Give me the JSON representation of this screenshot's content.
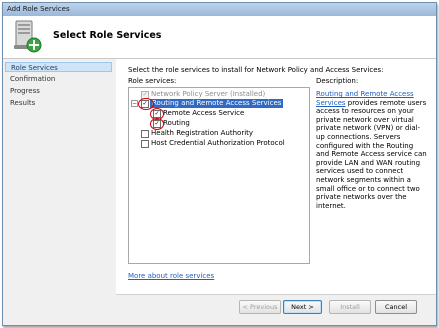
{
  "window": {
    "title": "Add Role Services"
  },
  "header": {
    "title": "Select Role Services"
  },
  "nav": {
    "items": [
      {
        "label": "Role Services",
        "active": true
      },
      {
        "label": "Confirmation",
        "active": false
      },
      {
        "label": "Progress",
        "active": false
      },
      {
        "label": "Results",
        "active": false
      }
    ]
  },
  "content": {
    "instruction": "Select the role services to install for Network Policy and Access Services:",
    "role_services_label": "Role services:",
    "description_label": "Description:",
    "tree": [
      {
        "label": "Network Policy Server  (Installed)",
        "checked": true,
        "disabled": true,
        "level": 0
      },
      {
        "label": "Routing and Remote Access Services",
        "checked": true,
        "disabled": false,
        "level": 0,
        "selected": true,
        "expanded": true
      },
      {
        "label": "Remote Access Service",
        "checked": true,
        "disabled": false,
        "level": 1
      },
      {
        "label": "Routing",
        "checked": true,
        "disabled": false,
        "level": 1
      },
      {
        "label": "Health Registration Authority",
        "checked": false,
        "disabled": false,
        "level": 0
      },
      {
        "label": "Host Credential Authorization Protocol",
        "checked": false,
        "disabled": false,
        "level": 0
      }
    ],
    "description_link": "Routing and Remote Access Services",
    "description_text": " provides remote users access to resources on your private network over virtual private network (VPN) or dial-up connections. Servers configured with the Routing and Remote Access service can provide LAN and WAN routing services used to connect network segments within a small office or to connect two private networks over the internet.",
    "more_link": "More about role services"
  },
  "buttons": {
    "previous": "< Previous",
    "next": "Next >",
    "install": "Install",
    "cancel": "Cancel"
  }
}
